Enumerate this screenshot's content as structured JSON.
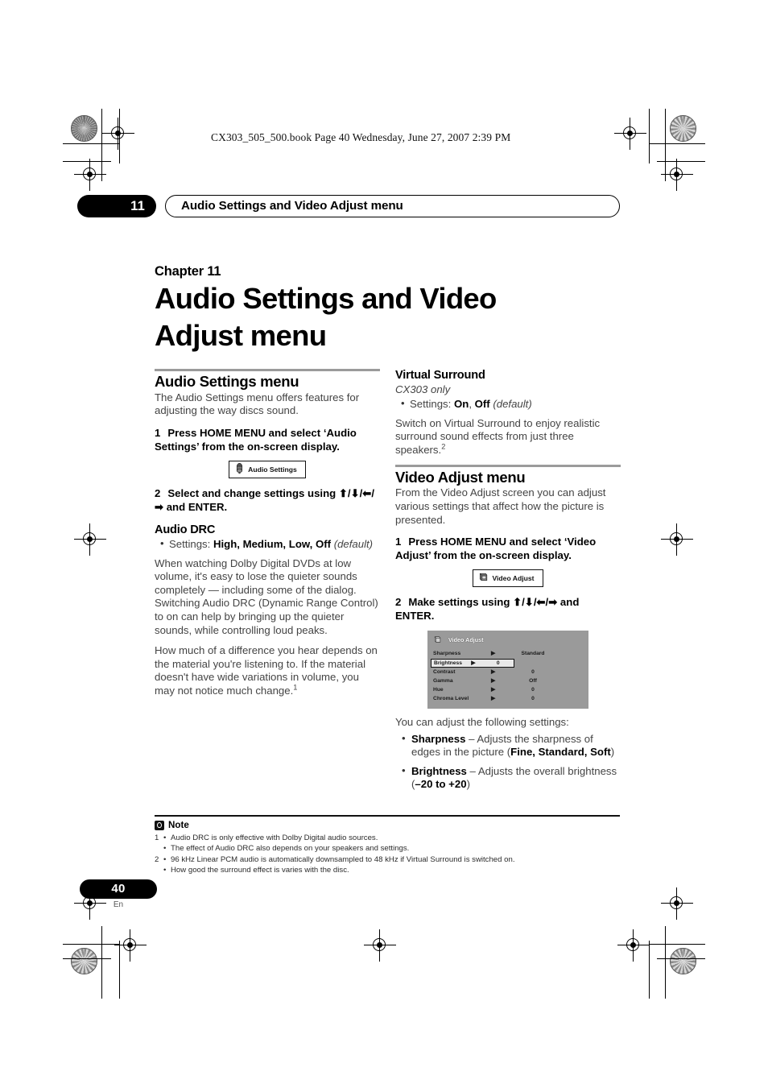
{
  "print": {
    "book_line": "CX303_505_500.book  Page 40  Wednesday, June 27, 2007  2:39 PM"
  },
  "running_head": {
    "chapter_number": "11",
    "title": "Audio Settings and Video Adjust menu"
  },
  "chapter": {
    "kicker": "Chapter 11",
    "title_line1": "Audio Settings and Video",
    "title_line2": "Adjust menu"
  },
  "left_column": {
    "section_title": "Audio Settings menu",
    "intro": "The Audio Settings menu offers features for adjusting the way discs sound.",
    "step1_num": "1",
    "step1_text": "Press HOME MENU and select ‘Audio Settings’ from the on-screen display.",
    "osd_chip_label": "Audio Settings",
    "step2_num": "2",
    "step2_text_a": "Select and change settings using ",
    "step2_arrows_a": "⬆/⬇/",
    "step2_arrows_b": "⬅/➡",
    "step2_text_b": " and ENTER.",
    "audio_drc_heading": "Audio DRC",
    "audio_drc_settings_label": "Settings: ",
    "audio_drc_options": "High, Medium, Low, Off",
    "audio_drc_default": "(default)",
    "para1": "When watching Dolby Digital DVDs at low volume, it's easy to lose the quieter sounds completely — including some of the dialog. Switching Audio DRC (Dynamic Range Control) to on can help by bringing up the quieter sounds, while controlling loud peaks.",
    "para2": "How much of a difference you hear depends on the material you're listening to. If the material doesn't have wide variations in volume, you may not notice much change.",
    "para2_footnote": "1"
  },
  "right_column": {
    "virtual_surround_heading": "Virtual Surround",
    "virtual_surround_model": "CX303 only",
    "vs_settings_label": "Settings: ",
    "vs_option_on": "On",
    "vs_option_off": "Off",
    "vs_default": "(default)",
    "vs_para": "Switch on Virtual Surround to enjoy realistic surround sound effects from just three speakers.",
    "vs_para_footnote": "2",
    "section_title": "Video Adjust menu",
    "intro": "From the Video Adjust screen you can adjust various settings that affect how the picture is presented.",
    "step1_num": "1",
    "step1_text": "Press HOME MENU and select ‘Video Adjust’ from the on-screen display.",
    "osd_chip_label": "Video Adjust",
    "step2_num": "2",
    "step2_text_a": "Make settings using ",
    "step2_arrows": "⬆/⬇/⬅/➡",
    "step2_text_b": " and ENTER.",
    "osd_panel": {
      "title": "Video Adjust",
      "arrow_glyph": "▶",
      "rows": [
        {
          "label": "Sharpness",
          "value": "Standard",
          "selected": false
        },
        {
          "label": "Brightness",
          "value": "0",
          "selected": true
        },
        {
          "label": "Contrast",
          "value": "0",
          "selected": false
        },
        {
          "label": "Gamma",
          "value": "Off",
          "selected": false
        },
        {
          "label": "Hue",
          "value": "0",
          "selected": false
        },
        {
          "label": "Chroma Level",
          "value": "0",
          "selected": false
        }
      ]
    },
    "adjust_lead": "You can adjust the following settings:",
    "adjust_items": [
      {
        "term": "Sharpness",
        "dash": " – ",
        "desc_a": "Adjusts the sharpness of edges in the picture (",
        "opts": "Fine, Standard, Soft",
        "desc_b": ")"
      },
      {
        "term": "Brightness",
        "dash": " – ",
        "desc_a": "Adjusts the overall brightness (",
        "opts": "–20 to +20",
        "desc_b": ")"
      }
    ]
  },
  "notes": {
    "heading": "Note",
    "items": [
      {
        "num": "1",
        "bullet": "•",
        "text": "Audio DRC is only effective with Dolby Digital audio sources."
      },
      {
        "num": "",
        "bullet": "•",
        "text": "The effect of Audio DRC also depends on your speakers and settings."
      },
      {
        "num": "2",
        "bullet": "•",
        "text": "96 kHz Linear PCM audio is automatically downsampled to 48 kHz if Virtual Surround is switched on."
      },
      {
        "num": "",
        "bullet": "•",
        "text": "How good the surround effect is varies with the disc."
      }
    ]
  },
  "footer": {
    "page_number": "40",
    "language": "En"
  }
}
